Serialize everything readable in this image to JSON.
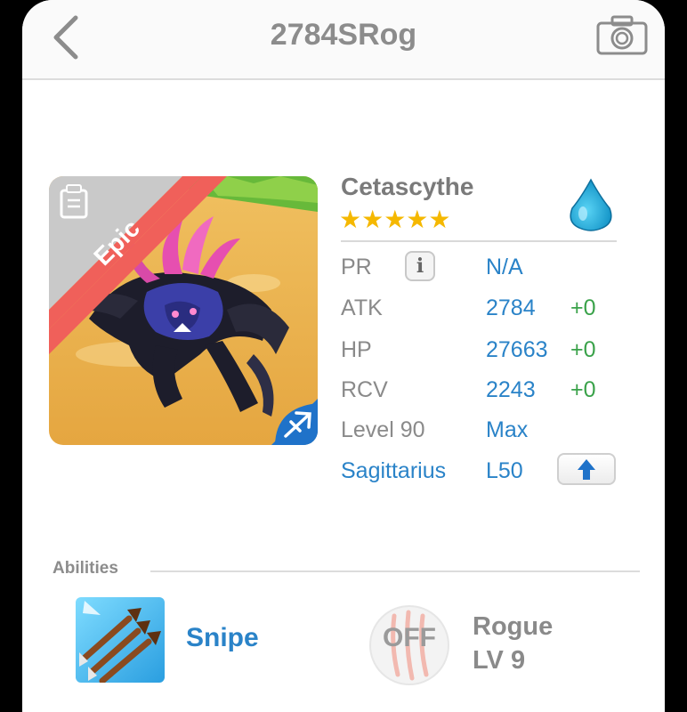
{
  "nav": {
    "title": "2784SRog",
    "back_icon": "chevron-left-icon",
    "camera_icon": "camera-icon"
  },
  "monster": {
    "name": "Cetascythe",
    "rarity": "Epic",
    "stars": "★★★★★",
    "star_count": 5,
    "element_icon": "water-drop-icon",
    "element_color": "#1fa7d8",
    "sign_icon": "sagittarius-arrow-icon"
  },
  "stats": {
    "pr": {
      "label": "PR",
      "value": "N/A"
    },
    "atk": {
      "label": "ATK",
      "value": "2784",
      "bonus": "+0"
    },
    "hp": {
      "label": "HP",
      "value": "27663",
      "bonus": "+0"
    },
    "rcv": {
      "label": "RCV",
      "value": "2243",
      "bonus": "+0"
    },
    "level": {
      "label": "Level 90",
      "value": "Max"
    },
    "sign": {
      "label": "Sagittarius",
      "value": "L50"
    }
  },
  "abilities": {
    "title": "Abilities",
    "active": {
      "name": "Snipe",
      "icon": "triple-arrow-icon"
    },
    "passive": {
      "status": "OFF",
      "name": "Rogue",
      "level": "LV 9",
      "icon": "claw-scratch-icon"
    }
  },
  "colors": {
    "accent": "#2a83c8",
    "bonus": "#3aa24a",
    "epic": "#f0605a",
    "star": "#f5b800"
  }
}
